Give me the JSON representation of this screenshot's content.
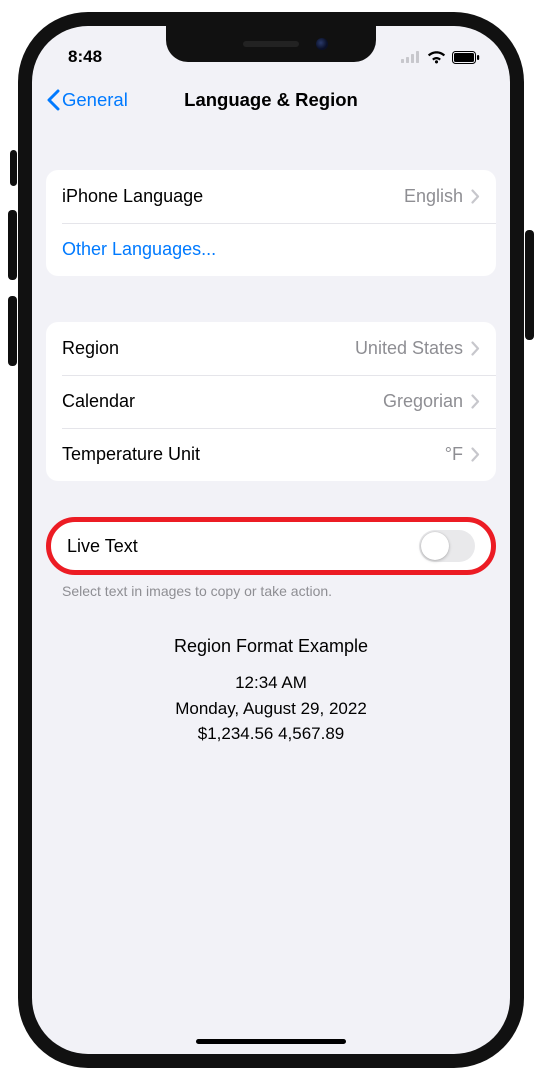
{
  "status": {
    "time": "8:48"
  },
  "nav": {
    "back_label": "General",
    "title": "Language & Region"
  },
  "group1": {
    "iphone_language_label": "iPhone Language",
    "iphone_language_value": "English",
    "other_languages_label": "Other Languages..."
  },
  "group2": {
    "region_label": "Region",
    "region_value": "United States",
    "calendar_label": "Calendar",
    "calendar_value": "Gregorian",
    "temperature_label": "Temperature Unit",
    "temperature_value": "°F"
  },
  "group3": {
    "live_text_label": "Live Text",
    "live_text_footer": "Select text in images to copy or take action."
  },
  "example": {
    "title": "Region Format Example",
    "time": "12:34 AM",
    "date": "Monday, August 29, 2022",
    "money": "$1,234.56   4,567.89"
  }
}
